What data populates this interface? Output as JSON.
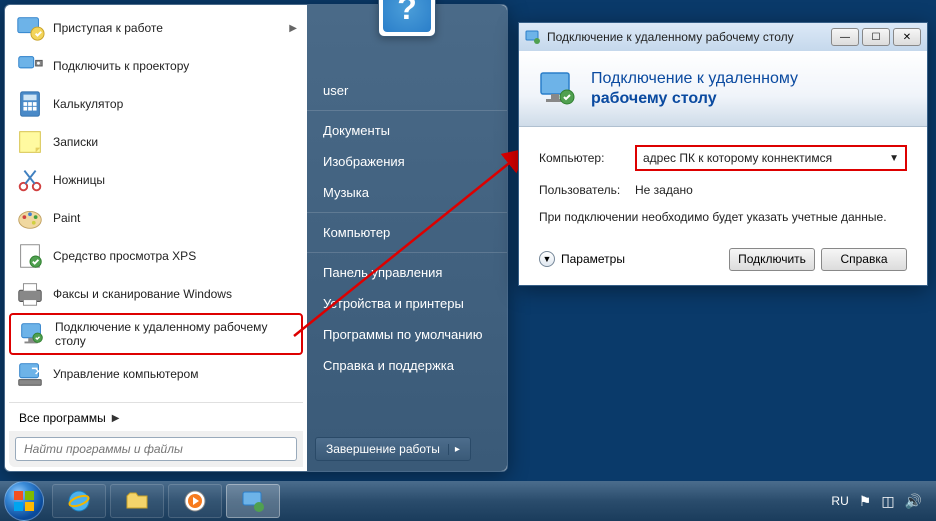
{
  "start_menu": {
    "programs": [
      {
        "label": "Приступая к работе",
        "has_sub": true,
        "icon": "getstarted"
      },
      {
        "label": "Подключить к проектору",
        "has_sub": false,
        "icon": "projector"
      },
      {
        "label": "Калькулятор",
        "has_sub": false,
        "icon": "calc"
      },
      {
        "label": "Записки",
        "has_sub": false,
        "icon": "notes"
      },
      {
        "label": "Ножницы",
        "has_sub": false,
        "icon": "snip"
      },
      {
        "label": "Paint",
        "has_sub": false,
        "icon": "paint"
      },
      {
        "label": "Средство просмотра XPS",
        "has_sub": false,
        "icon": "xps"
      },
      {
        "label": "Факсы и сканирование Windows",
        "has_sub": false,
        "icon": "fax"
      },
      {
        "label": "Подключение к удаленному рабочему столу",
        "has_sub": false,
        "icon": "rdp",
        "highlight": true
      },
      {
        "label": "Управление компьютером",
        "has_sub": false,
        "icon": "mgmt"
      }
    ],
    "all_programs": "Все программы",
    "search_placeholder": "Найти программы и файлы",
    "right_items": [
      "user",
      "Документы",
      "Изображения",
      "Музыка",
      "Компьютер",
      "Панель управления",
      "Устройства и принтеры",
      "Программы по умолчанию",
      "Справка и поддержка"
    ],
    "shutdown": "Завершение работы"
  },
  "dialog": {
    "title": "Подключение к удаленному рабочему столу",
    "header_line1": "Подключение к удаленному",
    "header_line2": "рабочему столу",
    "computer_label": "Компьютер:",
    "computer_value": "адрес ПК к которому коннектимся",
    "user_label": "Пользователь:",
    "user_value": "Не задано",
    "note": "При подключении необходимо будет указать учетные данные.",
    "expand": "Параметры",
    "connect": "Подключить",
    "help": "Справка"
  },
  "taskbar": {
    "lang": "RU"
  },
  "colors": {
    "highlight": "#d00000",
    "accent": "#0a4aa0"
  }
}
